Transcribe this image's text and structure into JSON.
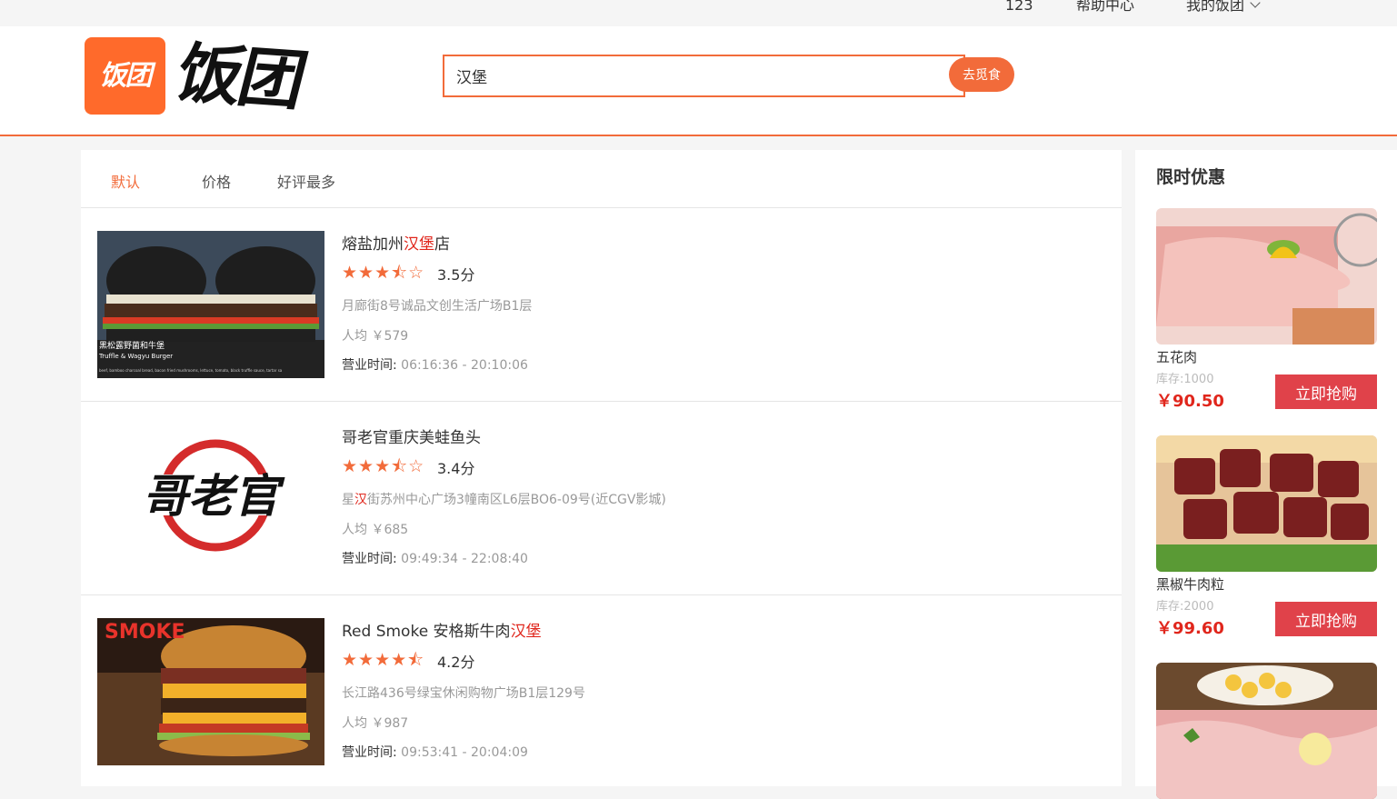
{
  "topbar": {
    "user": "123",
    "help": "帮助中心",
    "my": "我的饭团"
  },
  "logo": {
    "badge": "饭团",
    "text": "饭团"
  },
  "search": {
    "value": "汉堡",
    "button": "去觅食"
  },
  "tabs": [
    "默认",
    "价格",
    "好评最多"
  ],
  "shops": [
    {
      "name_pre": "熔盐加州",
      "name_hl": "汉堡",
      "name_post": "店",
      "stars": "★★★⯪☆",
      "score": "3.5分",
      "addr_pre": "月廊街8号诚品文创生活广场B1层",
      "addr_hl": "",
      "addr_post": "",
      "avg": "人均 ￥579",
      "hours_label": "营业时间:",
      "hours": "06:16:36 - 20:10:06",
      "img_caption": "黑松露野菌和牛堡",
      "img_caption2": "Truffle & Wagyu Burger",
      "img_caption3": "beef, bamboo charcoal bread, bacon fried mushrooms, lettuce, tomato, black truffle sauce, tartar sa"
    },
    {
      "name_pre": "哥老官重庆美蛙鱼头",
      "name_hl": "",
      "name_post": "",
      "stars": "★★★⯪☆",
      "score": "3.4分",
      "addr_pre": "星",
      "addr_hl": "汉",
      "addr_post": "街苏州中心广场3幢南区L6层BO6-09号(近CGV影城)",
      "avg": "人均 ￥685",
      "hours_label": "营业时间:",
      "hours": "09:49:34 - 22:08:40",
      "img_logo": "哥老官"
    },
    {
      "name_pre": "Red Smoke 安格斯牛肉",
      "name_hl": "汉堡",
      "name_post": "",
      "stars": "★★★★⯪",
      "score": "4.2分",
      "addr_pre": "长江路436号绿宝休闲购物广场B1层129号",
      "addr_hl": "",
      "addr_post": "",
      "avg": "人均 ￥987",
      "hours_label": "营业时间:",
      "hours": "09:53:41 - 20:04:09",
      "img_caption": "SMOKE"
    }
  ],
  "deals": {
    "title": "限时优惠",
    "items": [
      {
        "name": "五花肉",
        "stock": "库存:1000",
        "price": "￥90.50",
        "button": "立即抢购"
      },
      {
        "name": "黑椒牛肉粒",
        "stock": "库存:2000",
        "price": "￥99.60",
        "button": "立即抢购"
      }
    ]
  },
  "colors": {
    "accent": "#f26b3a",
    "highlight": "#e0261c",
    "buy": "#e0424a"
  }
}
